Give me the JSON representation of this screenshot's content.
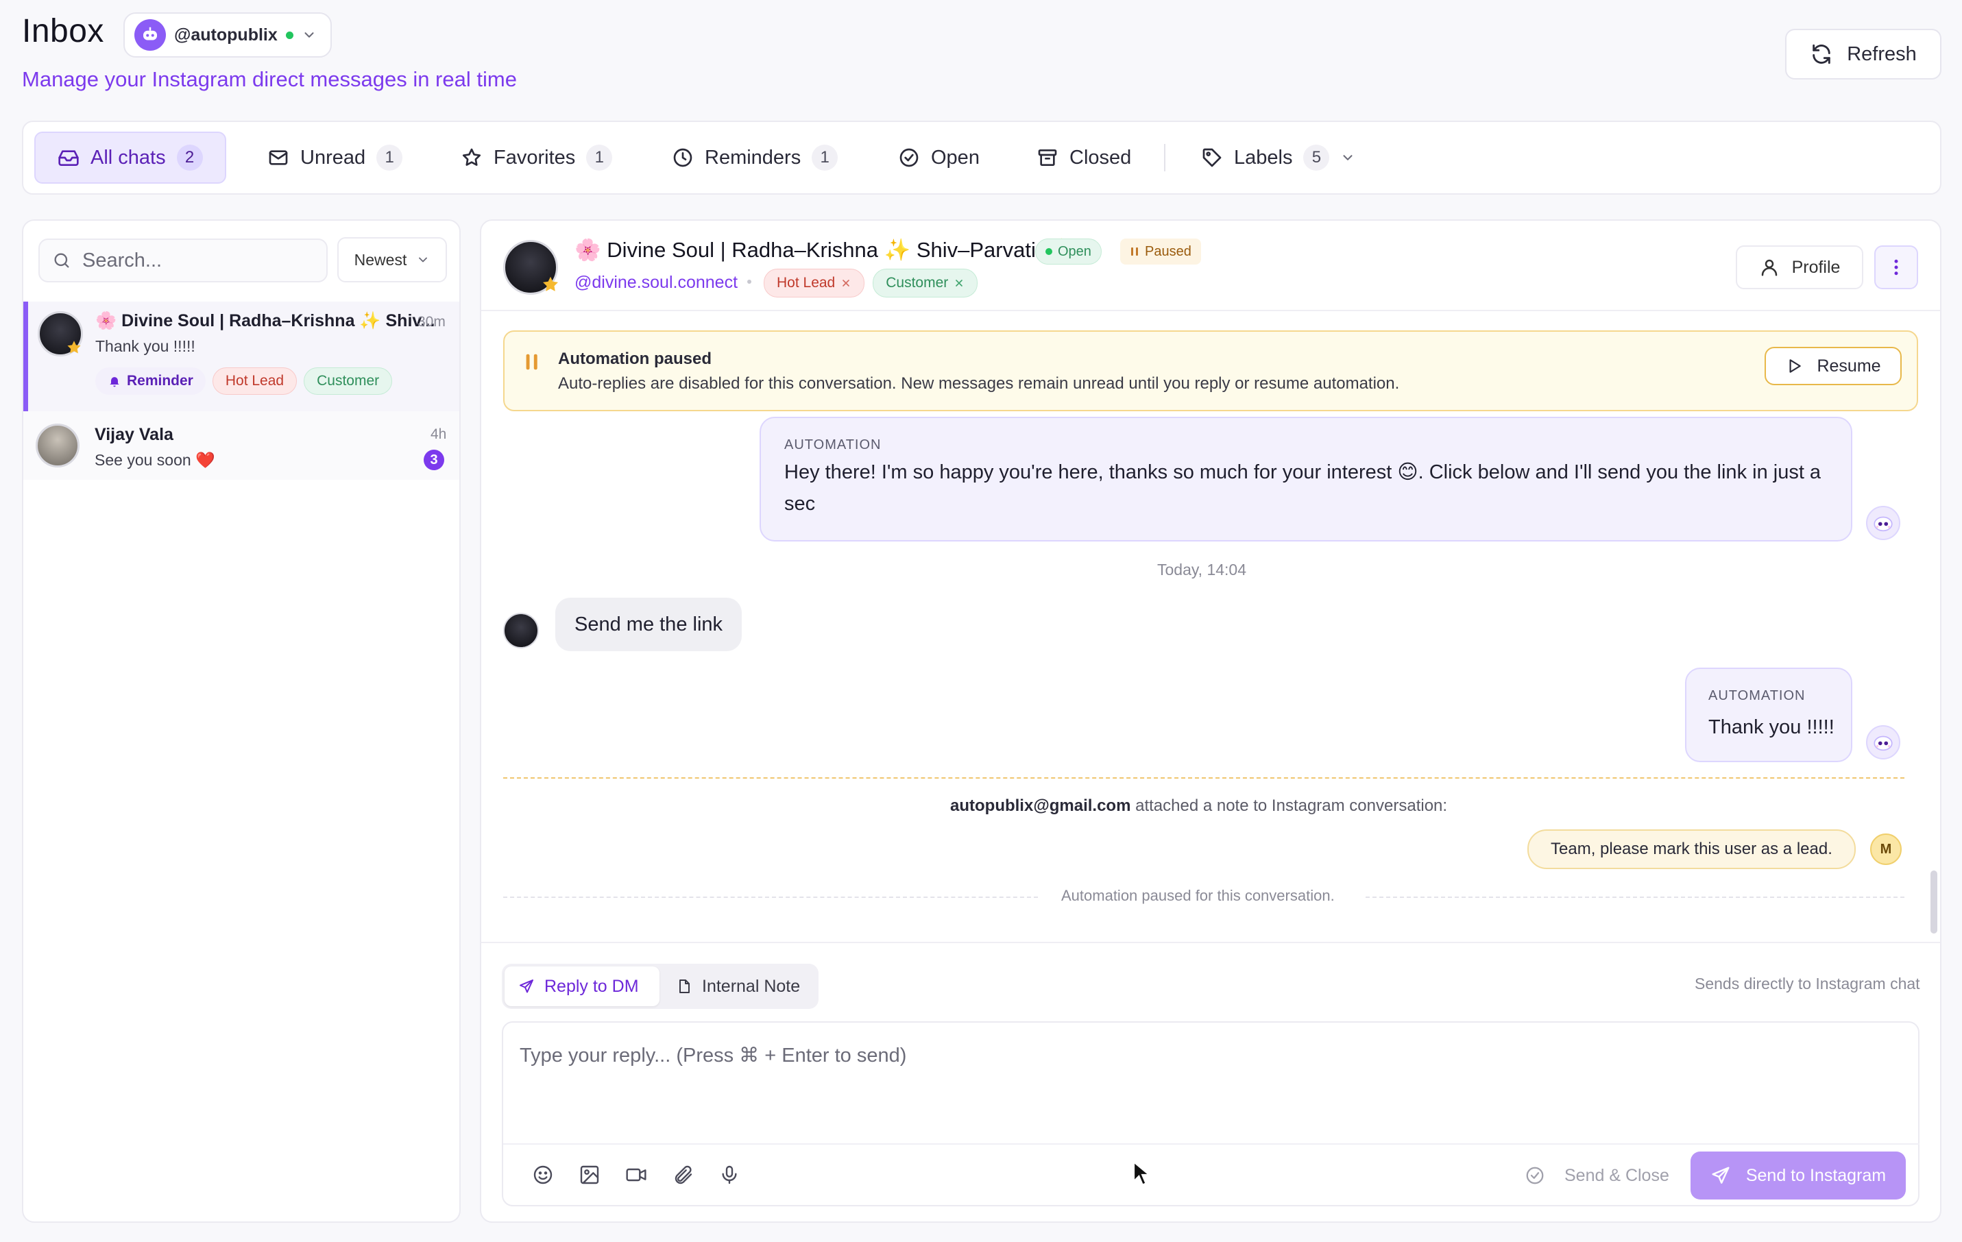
{
  "header": {
    "title": "Inbox",
    "account_handle": "@autopublix",
    "subtitle": "Manage your Instagram direct messages in real time",
    "refresh_label": "Refresh"
  },
  "filters": [
    {
      "label": "All chats",
      "count": "2",
      "icon": "inbox-icon",
      "active": true
    },
    {
      "label": "Unread",
      "count": "1",
      "icon": "mail-icon"
    },
    {
      "label": "Favorites",
      "count": "1",
      "icon": "star-icon"
    },
    {
      "label": "Reminders",
      "count": "1",
      "icon": "clock-icon"
    },
    {
      "label": "Open",
      "count": "",
      "icon": "check-circle-icon"
    },
    {
      "label": "Closed",
      "count": "",
      "icon": "archive-icon"
    },
    {
      "label": "Labels",
      "count": "5",
      "icon": "tag-icon"
    }
  ],
  "sidebar": {
    "search_placeholder": "Search...",
    "sort_label": "Newest",
    "chats": [
      {
        "name": "🌸 Divine Soul | Radha–Krishna ✨ Shiv...",
        "time": "30m",
        "preview": "Thank you !!!!!",
        "tags": [
          "Reminder",
          "Hot Lead",
          "Customer"
        ],
        "favorite": true
      },
      {
        "name": "Vijay Vala",
        "time": "4h",
        "preview": "See you soon ❤️",
        "unread": "3"
      }
    ]
  },
  "conversation": {
    "name": "🌸 Divine Soul | Radha–Krishna ✨ Shiv–Parvati 💖",
    "status_open": "Open",
    "status_paused": "Paused",
    "handle": "@divine.soul.connect",
    "tags": [
      "Hot Lead",
      "Customer"
    ],
    "profile_label": "Profile",
    "banner": {
      "title": "Automation paused",
      "text": "Auto-replies are disabled for this conversation. New messages remain unread until you reply or resume automation.",
      "resume_label": "Resume"
    },
    "messages": [
      {
        "type": "automation",
        "label": "AUTOMATION",
        "line1": "Hey there! I'm so happy you're here, thanks so much for your interest 😊. Click below and I'll send you the link in just a",
        "line2": "sec"
      },
      {
        "type": "timestamp",
        "text": "Today, 14:04"
      },
      {
        "type": "user",
        "text": "Send me the link"
      },
      {
        "type": "automation",
        "label": "AUTOMATION",
        "text": "Thank you !!!!!"
      }
    ],
    "note": {
      "author": "autopublix@gmail.com",
      "caption_rest": " attached a note to Instagram conversation:",
      "text": "Team, please mark this user as a lead.",
      "avatar_initial": "M"
    },
    "paused_note": "Automation paused for this conversation."
  },
  "composer": {
    "reply_tab": "Reply to DM",
    "note_tab": "Internal Note",
    "hint": "Sends directly to Instagram chat",
    "placeholder": "Type your reply... (Press ⌘ + Enter to send)",
    "tools": [
      "emoji-icon",
      "image-icon",
      "video-icon",
      "attachment-icon",
      "microphone-icon"
    ],
    "send_close_label": "Send & Close",
    "send_label": "Send to Instagram"
  },
  "colors": {
    "accent": "#7c3aed",
    "accent_light": "#ede9fe",
    "hot_lead": "#c0392b",
    "customer": "#2f8f5b",
    "paused_bg": "#fefbea"
  }
}
